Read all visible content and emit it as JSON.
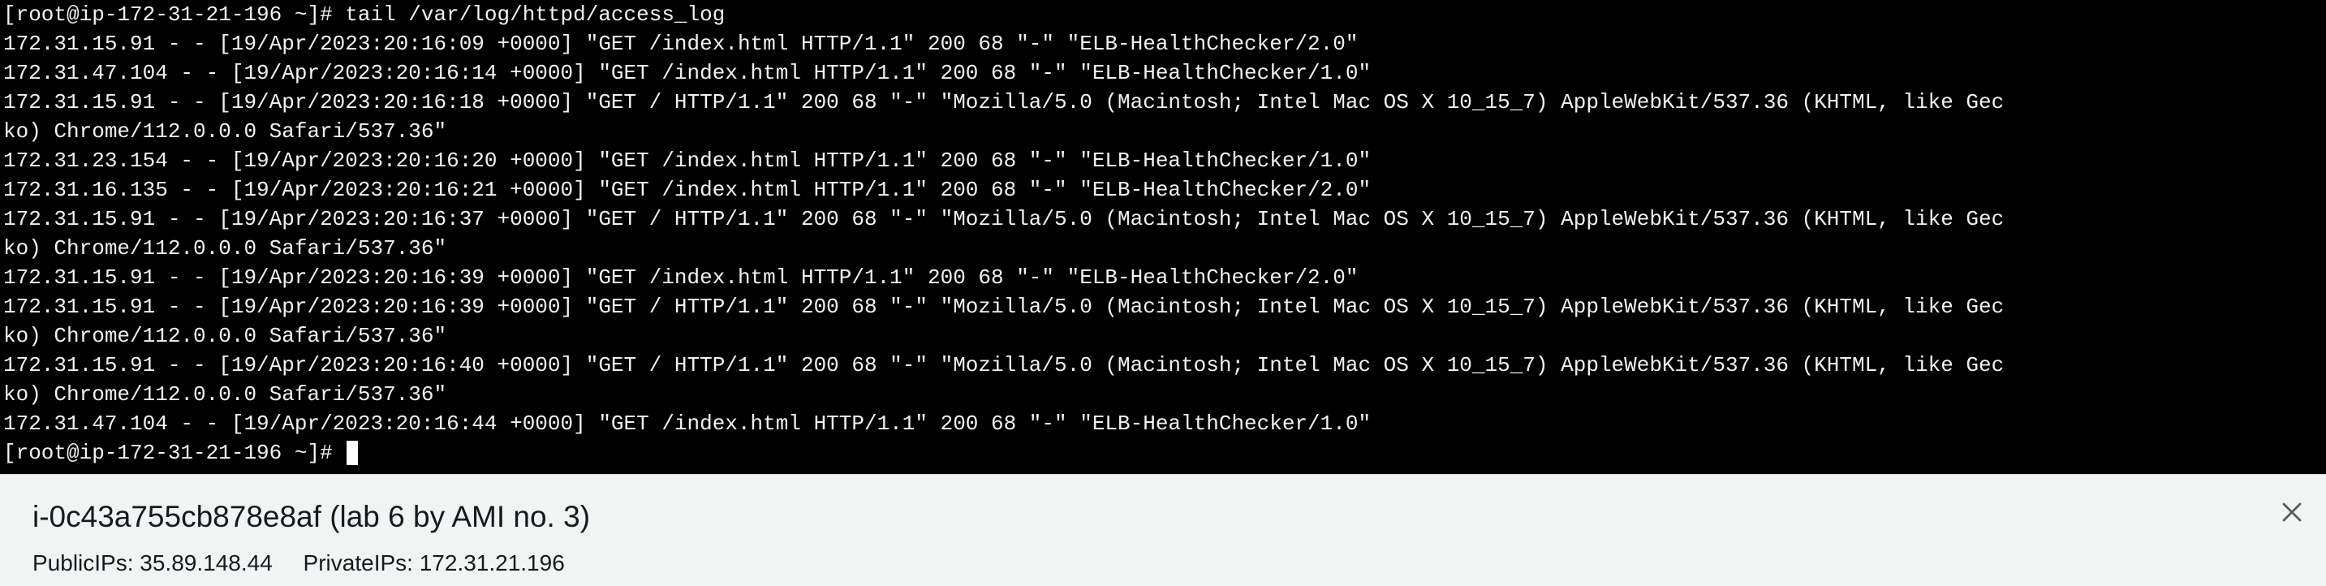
{
  "terminal": {
    "lines": [
      "[root@ip-172-31-21-196 ~]# tail /var/log/httpd/access_log",
      "[root@ip-172-31-21-196 ~]# tail /var/log/httpd/access_log",
      "172.31.15.91 - - [19/Apr/2023:20:16:09 +0000] \"GET /index.html HTTP/1.1\" 200 68 \"-\" \"ELB-HealthChecker/2.0\"",
      "172.31.47.104 - - [19/Apr/2023:20:16:14 +0000] \"GET /index.html HTTP/1.1\" 200 68 \"-\" \"ELB-HealthChecker/1.0\"",
      "172.31.15.91 - - [19/Apr/2023:20:16:18 +0000] \"GET / HTTP/1.1\" 200 68 \"-\" \"Mozilla/5.0 (Macintosh; Intel Mac OS X 10_15_7) AppleWebKit/537.36 (KHTML, like Gec",
      "ko) Chrome/112.0.0.0 Safari/537.36\"",
      "172.31.23.154 - - [19/Apr/2023:20:16:20 +0000] \"GET /index.html HTTP/1.1\" 200 68 \"-\" \"ELB-HealthChecker/1.0\"",
      "172.31.16.135 - - [19/Apr/2023:20:16:21 +0000] \"GET /index.html HTTP/1.1\" 200 68 \"-\" \"ELB-HealthChecker/2.0\"",
      "172.31.15.91 - - [19/Apr/2023:20:16:37 +0000] \"GET / HTTP/1.1\" 200 68 \"-\" \"Mozilla/5.0 (Macintosh; Intel Mac OS X 10_15_7) AppleWebKit/537.36 (KHTML, like Gec",
      "ko) Chrome/112.0.0.0 Safari/537.36\"",
      "172.31.15.91 - - [19/Apr/2023:20:16:39 +0000] \"GET /index.html HTTP/1.1\" 200 68 \"-\" \"ELB-HealthChecker/2.0\"",
      "172.31.15.91 - - [19/Apr/2023:20:16:39 +0000] \"GET / HTTP/1.1\" 200 68 \"-\" \"Mozilla/5.0 (Macintosh; Intel Mac OS X 10_15_7) AppleWebKit/537.36 (KHTML, like Gec",
      "ko) Chrome/112.0.0.0 Safari/537.36\"",
      "172.31.15.91 - - [19/Apr/2023:20:16:40 +0000] \"GET / HTTP/1.1\" 200 68 \"-\" \"Mozilla/5.0 (Macintosh; Intel Mac OS X 10_15_7) AppleWebKit/537.36 (KHTML, like Gec",
      "ko) Chrome/112.0.0.0 Safari/537.36\"",
      "172.31.47.104 - - [19/Apr/2023:20:16:44 +0000] \"GET /index.html HTTP/1.1\" 200 68 \"-\" \"ELB-HealthChecker/1.0\""
    ],
    "prompt": "[root@ip-172-31-21-196 ~]# "
  },
  "info_panel": {
    "instance_title": "i-0c43a755cb878e8af (lab 6 by AMI no. 3)",
    "public_ips": "PublicIPs: 35.89.148.44",
    "private_ips": "PrivateIPs: 172.31.21.196",
    "close_icon": "close-icon"
  },
  "colors": {
    "terminal_bg": "#000000",
    "terminal_fg": "#f2f2f2",
    "panel_bg": "#f2f3f3",
    "panel_text": "#16191f"
  }
}
